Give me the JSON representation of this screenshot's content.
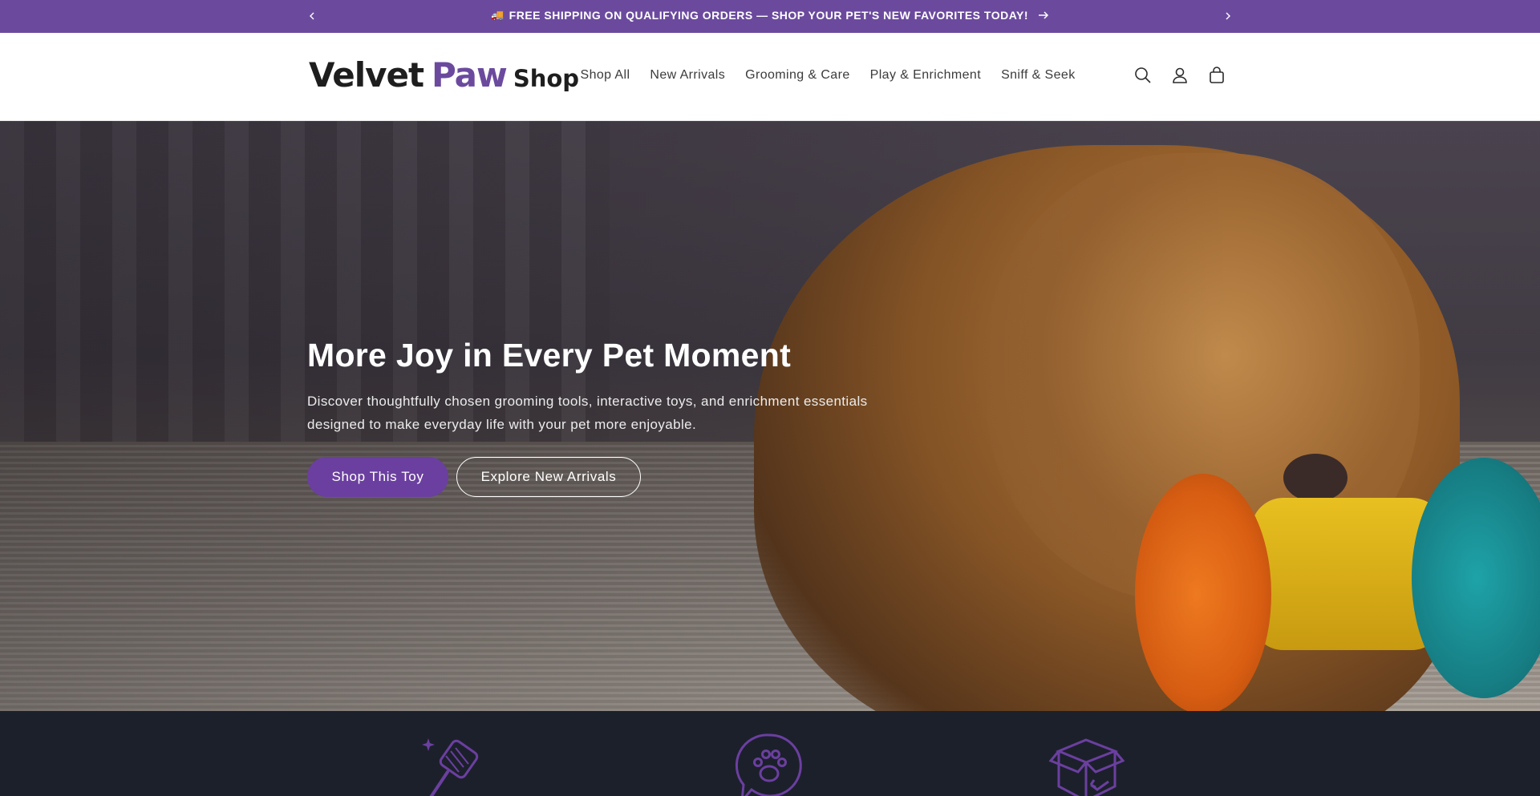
{
  "announcement": {
    "text": "FREE SHIPPING ON QUALIFYING ORDERS — SHOP YOUR PET'S NEW FAVORITES TODAY!",
    "emoji": "🚚"
  },
  "header": {
    "logo": {
      "word1": "Velvet",
      "word2": "Paw",
      "word3": "Shop"
    },
    "nav": [
      {
        "label": "Shop All"
      },
      {
        "label": "New Arrivals"
      },
      {
        "label": "Grooming & Care"
      },
      {
        "label": "Play & Enrichment"
      },
      {
        "label": "Sniff & Seek"
      }
    ],
    "icons": [
      "search-icon",
      "account-icon",
      "cart-icon"
    ]
  },
  "hero": {
    "title": "More Joy in Every Pet Moment",
    "subtitle": "Discover thoughtfully chosen grooming tools, interactive toys, and enrichment essentials designed to make everyday life with your pet more enjoyable.",
    "primary_button": "Shop This Toy",
    "secondary_button": "Explore New Arrivals"
  },
  "features": {
    "icons": [
      "grooming-brush-icon",
      "paw-chat-icon",
      "return-box-icon"
    ],
    "accent": "#6b3fa0"
  },
  "colors": {
    "brand": "#6b4a9e",
    "button": "#6b3fa0",
    "band": "#1c202b"
  }
}
